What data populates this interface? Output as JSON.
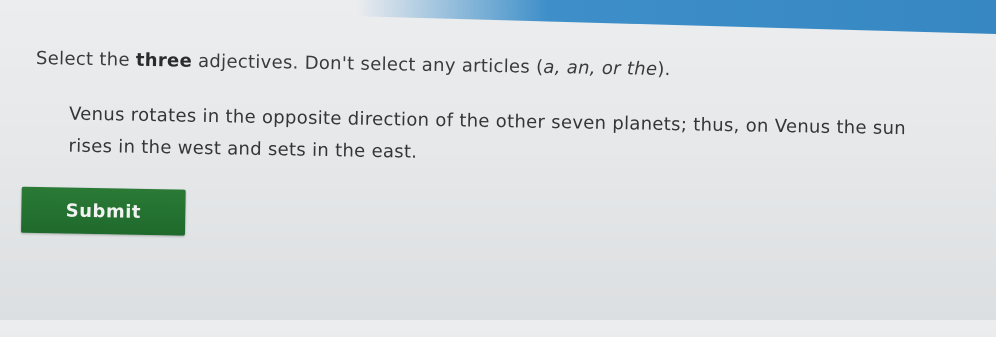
{
  "colors": {
    "accent_bar": "#3e8fc9",
    "submit_button": "#22702f",
    "background": "#e6e8ea"
  },
  "question": {
    "instruction_before": "Select the ",
    "instruction_emphasis": "three",
    "instruction_after": " adjectives. Don't select any articles (",
    "instruction_articles": "a, an, or the",
    "instruction_end": ").",
    "sentence": "Venus rotates in the opposite direction of the other seven planets; thus, on Venus the sun rises in the west and sets in the east."
  },
  "actions": {
    "submit_label": "Submit"
  }
}
